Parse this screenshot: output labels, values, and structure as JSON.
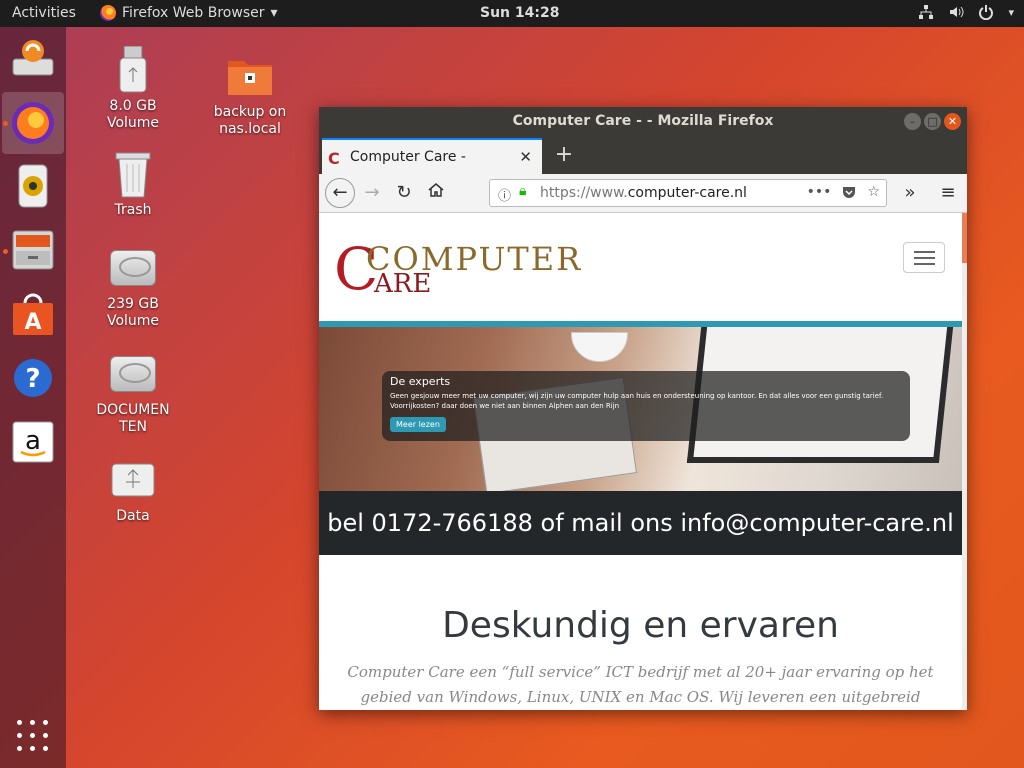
{
  "topbar": {
    "activities": "Activities",
    "app_name": "Firefox Web Browser",
    "app_arrow": "▾",
    "clock": "Sun 14:28",
    "tray_icons": [
      "network-icon",
      "volume-icon",
      "power-icon"
    ]
  },
  "dock": {
    "items": [
      "software-updater-icon",
      "firefox-icon",
      "rhythmbox-icon",
      "files-icon",
      "ubuntu-software-icon",
      "help-icon",
      "amazon-icon"
    ]
  },
  "desktop": {
    "icons": [
      {
        "label": "8.0 GB Volume"
      },
      {
        "label": "backup on nas.local"
      },
      {
        "label": "Trash"
      },
      {
        "label": "239 GB Volume"
      },
      {
        "label": "DOCUMEN TEN"
      },
      {
        "label": "Data"
      }
    ]
  },
  "window": {
    "title": "Computer Care - - Mozilla Firefox",
    "tab_label": "Computer Care -",
    "new_tab": "+",
    "url_prefix": "https://www.",
    "url_domain": "computer-care.nl",
    "url_rest": ""
  },
  "page": {
    "logo_top": "COMPUTER",
    "logo_bottom": "ARE",
    "logo_letter": "C",
    "caption_heading": "De experts",
    "caption_text": "Geen gesjouw meer met uw computer, wij zijn uw computer hulp aan huis en ondersteuning op kantoor. En dat alles voor een gunstig tarief. Voorrijkosten? daar doen we niet aan binnen Alphen aan den Rijn",
    "caption_button": "Meer lezen",
    "call_text": "bel 0172-766188 of mail ons info@computer-care.nl",
    "heading": "Deskundig en ervaren",
    "lead": "Computer Care een “full service” ICT bedrijf met al 20+ jaar ervaring op het gebied van Windows, Linux, UNIX en Mac OS. Wij leveren een uitgebreid pakket services"
  },
  "colors": {
    "accent_teal": "#2e99b3",
    "logo_red": "#b51b25",
    "logo_gold": "#8a6a2a",
    "tab_highlight": "#0a84ff"
  }
}
